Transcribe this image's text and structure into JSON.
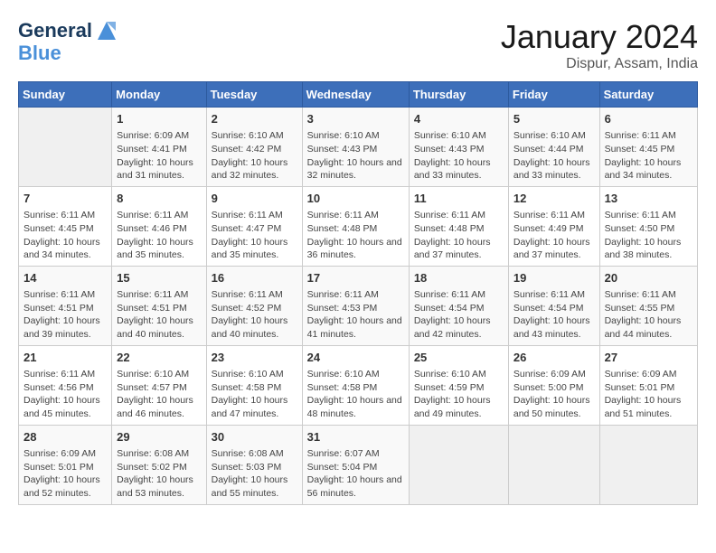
{
  "logo": {
    "line1": "General",
    "line2": "Blue"
  },
  "title": "January 2024",
  "location": "Dispur, Assam, India",
  "weekdays": [
    "Sunday",
    "Monday",
    "Tuesday",
    "Wednesday",
    "Thursday",
    "Friday",
    "Saturday"
  ],
  "weeks": [
    [
      {
        "day": "",
        "sunrise": "",
        "sunset": "",
        "daylight": ""
      },
      {
        "day": "1",
        "sunrise": "Sunrise: 6:09 AM",
        "sunset": "Sunset: 4:41 PM",
        "daylight": "Daylight: 10 hours and 31 minutes."
      },
      {
        "day": "2",
        "sunrise": "Sunrise: 6:10 AM",
        "sunset": "Sunset: 4:42 PM",
        "daylight": "Daylight: 10 hours and 32 minutes."
      },
      {
        "day": "3",
        "sunrise": "Sunrise: 6:10 AM",
        "sunset": "Sunset: 4:43 PM",
        "daylight": "Daylight: 10 hours and 32 minutes."
      },
      {
        "day": "4",
        "sunrise": "Sunrise: 6:10 AM",
        "sunset": "Sunset: 4:43 PM",
        "daylight": "Daylight: 10 hours and 33 minutes."
      },
      {
        "day": "5",
        "sunrise": "Sunrise: 6:10 AM",
        "sunset": "Sunset: 4:44 PM",
        "daylight": "Daylight: 10 hours and 33 minutes."
      },
      {
        "day": "6",
        "sunrise": "Sunrise: 6:11 AM",
        "sunset": "Sunset: 4:45 PM",
        "daylight": "Daylight: 10 hours and 34 minutes."
      }
    ],
    [
      {
        "day": "7",
        "sunrise": "Sunrise: 6:11 AM",
        "sunset": "Sunset: 4:45 PM",
        "daylight": "Daylight: 10 hours and 34 minutes."
      },
      {
        "day": "8",
        "sunrise": "Sunrise: 6:11 AM",
        "sunset": "Sunset: 4:46 PM",
        "daylight": "Daylight: 10 hours and 35 minutes."
      },
      {
        "day": "9",
        "sunrise": "Sunrise: 6:11 AM",
        "sunset": "Sunset: 4:47 PM",
        "daylight": "Daylight: 10 hours and 35 minutes."
      },
      {
        "day": "10",
        "sunrise": "Sunrise: 6:11 AM",
        "sunset": "Sunset: 4:48 PM",
        "daylight": "Daylight: 10 hours and 36 minutes."
      },
      {
        "day": "11",
        "sunrise": "Sunrise: 6:11 AM",
        "sunset": "Sunset: 4:48 PM",
        "daylight": "Daylight: 10 hours and 37 minutes."
      },
      {
        "day": "12",
        "sunrise": "Sunrise: 6:11 AM",
        "sunset": "Sunset: 4:49 PM",
        "daylight": "Daylight: 10 hours and 37 minutes."
      },
      {
        "day": "13",
        "sunrise": "Sunrise: 6:11 AM",
        "sunset": "Sunset: 4:50 PM",
        "daylight": "Daylight: 10 hours and 38 minutes."
      }
    ],
    [
      {
        "day": "14",
        "sunrise": "Sunrise: 6:11 AM",
        "sunset": "Sunset: 4:51 PM",
        "daylight": "Daylight: 10 hours and 39 minutes."
      },
      {
        "day": "15",
        "sunrise": "Sunrise: 6:11 AM",
        "sunset": "Sunset: 4:51 PM",
        "daylight": "Daylight: 10 hours and 40 minutes."
      },
      {
        "day": "16",
        "sunrise": "Sunrise: 6:11 AM",
        "sunset": "Sunset: 4:52 PM",
        "daylight": "Daylight: 10 hours and 40 minutes."
      },
      {
        "day": "17",
        "sunrise": "Sunrise: 6:11 AM",
        "sunset": "Sunset: 4:53 PM",
        "daylight": "Daylight: 10 hours and 41 minutes."
      },
      {
        "day": "18",
        "sunrise": "Sunrise: 6:11 AM",
        "sunset": "Sunset: 4:54 PM",
        "daylight": "Daylight: 10 hours and 42 minutes."
      },
      {
        "day": "19",
        "sunrise": "Sunrise: 6:11 AM",
        "sunset": "Sunset: 4:54 PM",
        "daylight": "Daylight: 10 hours and 43 minutes."
      },
      {
        "day": "20",
        "sunrise": "Sunrise: 6:11 AM",
        "sunset": "Sunset: 4:55 PM",
        "daylight": "Daylight: 10 hours and 44 minutes."
      }
    ],
    [
      {
        "day": "21",
        "sunrise": "Sunrise: 6:11 AM",
        "sunset": "Sunset: 4:56 PM",
        "daylight": "Daylight: 10 hours and 45 minutes."
      },
      {
        "day": "22",
        "sunrise": "Sunrise: 6:10 AM",
        "sunset": "Sunset: 4:57 PM",
        "daylight": "Daylight: 10 hours and 46 minutes."
      },
      {
        "day": "23",
        "sunrise": "Sunrise: 6:10 AM",
        "sunset": "Sunset: 4:58 PM",
        "daylight": "Daylight: 10 hours and 47 minutes."
      },
      {
        "day": "24",
        "sunrise": "Sunrise: 6:10 AM",
        "sunset": "Sunset: 4:58 PM",
        "daylight": "Daylight: 10 hours and 48 minutes."
      },
      {
        "day": "25",
        "sunrise": "Sunrise: 6:10 AM",
        "sunset": "Sunset: 4:59 PM",
        "daylight": "Daylight: 10 hours and 49 minutes."
      },
      {
        "day": "26",
        "sunrise": "Sunrise: 6:09 AM",
        "sunset": "Sunset: 5:00 PM",
        "daylight": "Daylight: 10 hours and 50 minutes."
      },
      {
        "day": "27",
        "sunrise": "Sunrise: 6:09 AM",
        "sunset": "Sunset: 5:01 PM",
        "daylight": "Daylight: 10 hours and 51 minutes."
      }
    ],
    [
      {
        "day": "28",
        "sunrise": "Sunrise: 6:09 AM",
        "sunset": "Sunset: 5:01 PM",
        "daylight": "Daylight: 10 hours and 52 minutes."
      },
      {
        "day": "29",
        "sunrise": "Sunrise: 6:08 AM",
        "sunset": "Sunset: 5:02 PM",
        "daylight": "Daylight: 10 hours and 53 minutes."
      },
      {
        "day": "30",
        "sunrise": "Sunrise: 6:08 AM",
        "sunset": "Sunset: 5:03 PM",
        "daylight": "Daylight: 10 hours and 55 minutes."
      },
      {
        "day": "31",
        "sunrise": "Sunrise: 6:07 AM",
        "sunset": "Sunset: 5:04 PM",
        "daylight": "Daylight: 10 hours and 56 minutes."
      },
      {
        "day": "",
        "sunrise": "",
        "sunset": "",
        "daylight": ""
      },
      {
        "day": "",
        "sunrise": "",
        "sunset": "",
        "daylight": ""
      },
      {
        "day": "",
        "sunrise": "",
        "sunset": "",
        "daylight": ""
      }
    ]
  ]
}
